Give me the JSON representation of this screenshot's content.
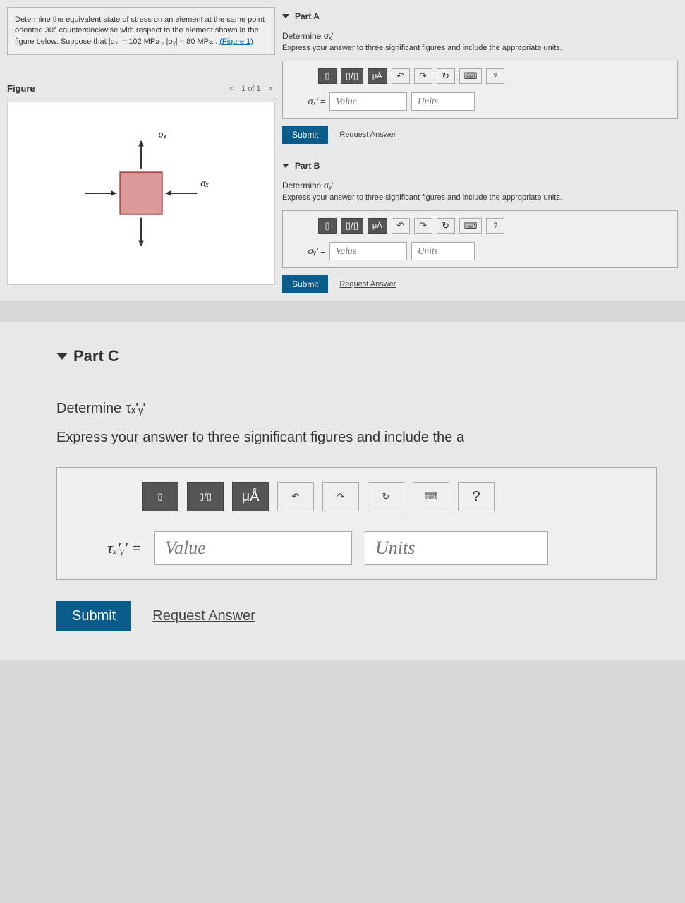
{
  "problem": {
    "text_prefix": "Determine the equivalent state of stress on an element at the same point oriented 30° counterclockwise with respect to the element shown in the figure below. Suppose that |σₓ| = 102 MPa , |σᵧ| = 80 MPa . ",
    "figure_link": "(Figure 1)"
  },
  "figure": {
    "title": "Figure",
    "counter": "1 of 1",
    "labels": {
      "sigma_x": "σₓ",
      "sigma_y": "σᵧ"
    }
  },
  "partA": {
    "title": "Part A",
    "prompt": "Determine σₓ'",
    "hint": "Express your answer to three significant figures and include the appropriate units.",
    "eq_label": "σₓ' =",
    "value_ph": "Value",
    "units_ph": "Units",
    "symbol_btn": "μÅ",
    "submit": "Submit",
    "request": "Request Answer"
  },
  "partB": {
    "title": "Part B",
    "prompt": "Determine σᵧ'",
    "hint": "Express your answer to three significant figures and include the appropriate units.",
    "eq_label": "σᵧ' =",
    "value_ph": "Value",
    "units_ph": "Units",
    "symbol_btn": "μÅ",
    "submit": "Submit",
    "request": "Request Answer"
  },
  "partC": {
    "title": "Part C",
    "prompt": "Determine τₓ'ᵧ'",
    "hint": "Express your answer to three significant figures and include the a",
    "eq_label": "τₓ'ᵧ' =",
    "value_ph": "Value",
    "units_ph": "Units",
    "symbol_btn": "μÅ",
    "submit": "Submit",
    "request": "Request Answer"
  },
  "tb": {
    "template": "▯",
    "fraction": "▯/▯",
    "undo": "↶",
    "redo": "↷",
    "reset": "↻",
    "keyboard": "⌨",
    "help": "?"
  }
}
